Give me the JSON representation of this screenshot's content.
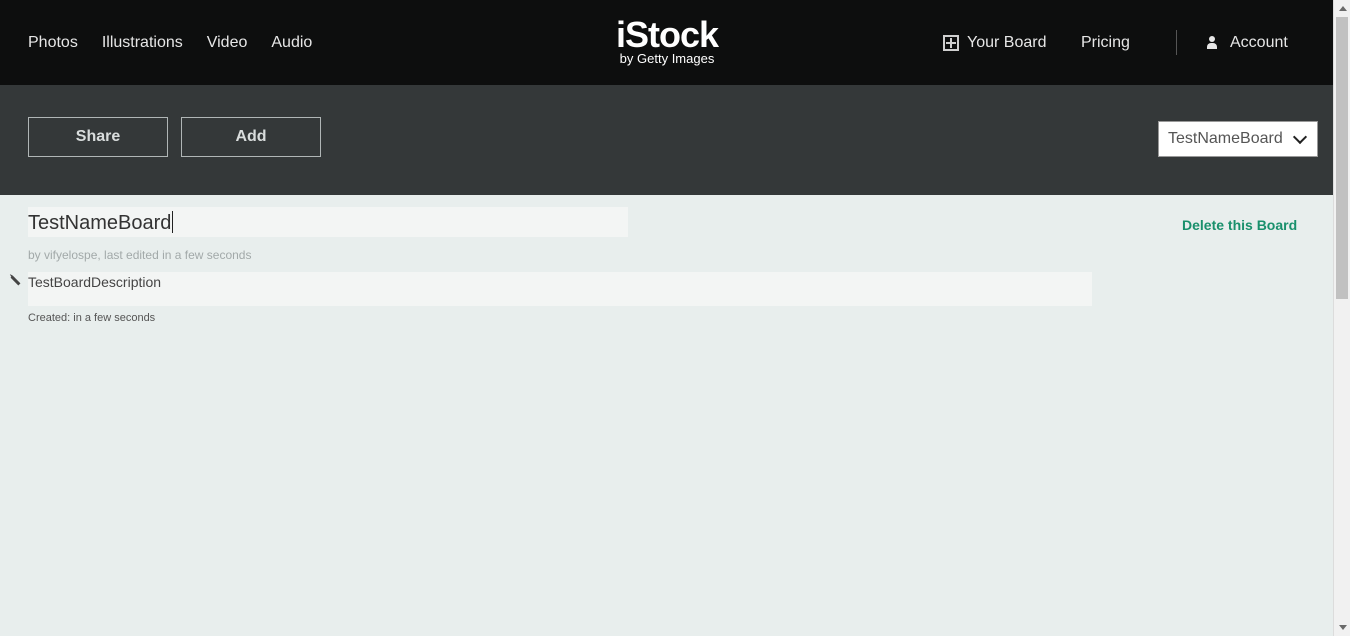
{
  "header": {
    "nav": [
      "Photos",
      "Illustrations",
      "Video",
      "Audio"
    ],
    "logo_main": "iStock",
    "logo_sub": "by Getty Images",
    "your_board": "Your Board",
    "pricing": "Pricing",
    "account": "Account"
  },
  "toolbar": {
    "share_label": "Share",
    "add_label": "Add",
    "board_select_value": "TestNameBoard"
  },
  "board": {
    "title": "TestNameBoard",
    "byline": "by vifyelospe, last edited in a few seconds",
    "delete_label": "Delete this Board",
    "description": "TestBoardDescription",
    "created": "Created: in a few seconds"
  },
  "colors": {
    "header_bg": "#0d0e0e",
    "toolbar_bg": "#343839",
    "content_bg": "#e8eeed",
    "accent_link": "#19906c"
  }
}
